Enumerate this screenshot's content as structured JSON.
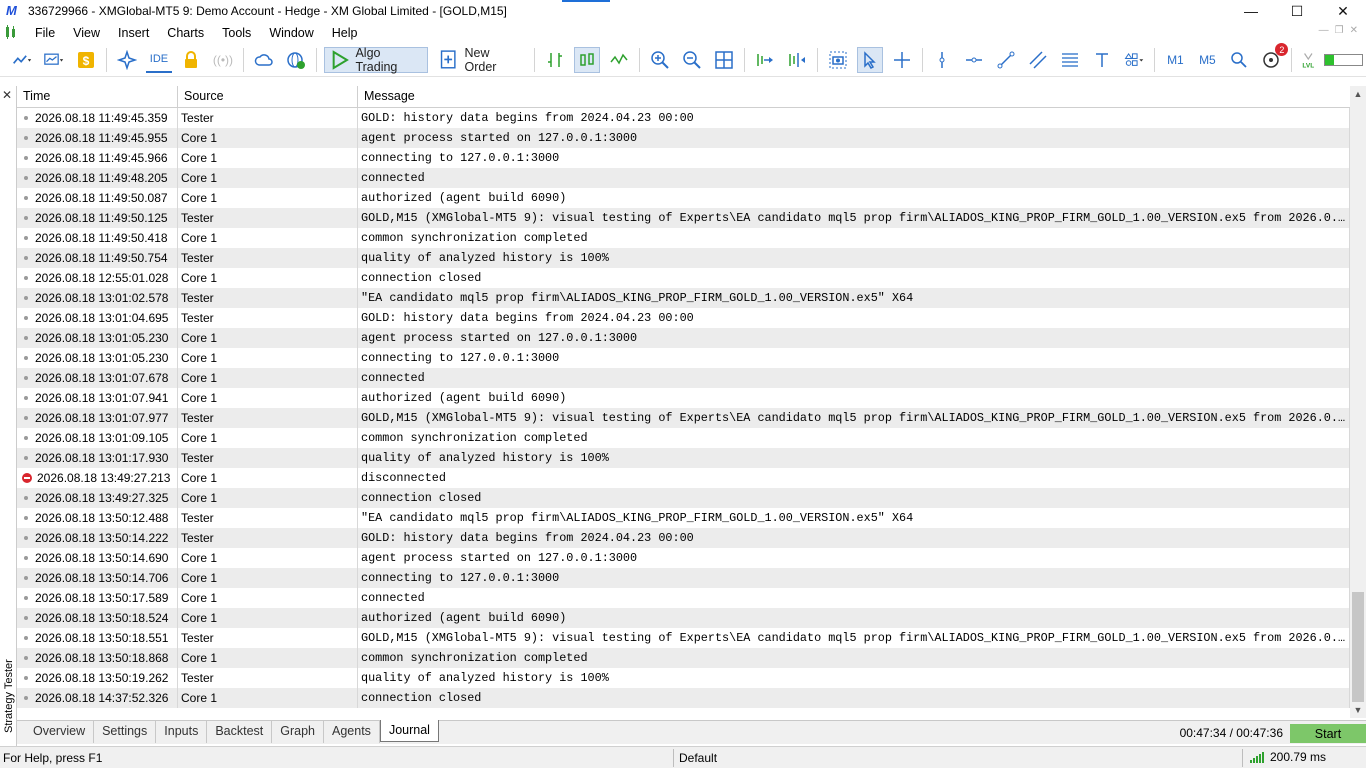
{
  "window": {
    "title": "336729966 - XMGlobal-MT5 9: Demo Account - Hedge - XM Global Limited - [GOLD,M15]",
    "logo": "M",
    "controls": [
      "minimize",
      "maximize",
      "close"
    ]
  },
  "menu": {
    "items": [
      "File",
      "View",
      "Insert",
      "Charts",
      "Tools",
      "Window",
      "Help"
    ]
  },
  "toolbar": {
    "ide_label": "IDE",
    "algo_trading_label": "Algo Trading",
    "new_order_label": "New Order",
    "timeframes": [
      "M1",
      "M5"
    ],
    "notifications_count": "2",
    "level_label": "LVL",
    "level_fraction": 0.25
  },
  "panel": {
    "vertical_label": "Strategy Tester",
    "close_glyph": "✕"
  },
  "journal": {
    "columns": [
      "Time",
      "Source",
      "Message"
    ],
    "rows": [
      {
        "time": "2026.08.18 11:49:45.359",
        "source": "Tester",
        "message": "GOLD: history data begins from 2024.04.23 00:00",
        "level": "info"
      },
      {
        "time": "2026.08.18 11:49:45.955",
        "source": "Core 1",
        "message": "agent process started on 127.0.0.1:3000",
        "level": "info"
      },
      {
        "time": "2026.08.18 11:49:45.966",
        "source": "Core 1",
        "message": "connecting to 127.0.0.1:3000",
        "level": "info"
      },
      {
        "time": "2026.08.18 11:49:48.205",
        "source": "Core 1",
        "message": "connected",
        "level": "info"
      },
      {
        "time": "2026.08.18 11:49:50.087",
        "source": "Core 1",
        "message": "authorized (agent build 6090)",
        "level": "info"
      },
      {
        "time": "2026.08.18 11:49:50.125",
        "source": "Tester",
        "message": "GOLD,M15 (XMGlobal-MT5 9): visual testing of Experts\\EA candidato mql5 prop firm\\ALIADOS_KING_PROP_FIRM_GOLD_1.00_VERSION.ex5 from 2026.0...",
        "level": "info"
      },
      {
        "time": "2026.08.18 11:49:50.418",
        "source": "Core 1",
        "message": "common synchronization completed",
        "level": "info"
      },
      {
        "time": "2026.08.18 11:49:50.754",
        "source": "Tester",
        "message": "quality of analyzed history is 100%",
        "level": "info"
      },
      {
        "time": "2026.08.18 12:55:01.028",
        "source": "Core 1",
        "message": "connection closed",
        "level": "info"
      },
      {
        "time": "2026.08.18 13:01:02.578",
        "source": "Tester",
        "message": "\"EA candidato mql5 prop firm\\ALIADOS_KING_PROP_FIRM_GOLD_1.00_VERSION.ex5\" X64",
        "level": "info"
      },
      {
        "time": "2026.08.18 13:01:04.695",
        "source": "Tester",
        "message": "GOLD: history data begins from 2024.04.23 00:00",
        "level": "info"
      },
      {
        "time": "2026.08.18 13:01:05.230",
        "source": "Core 1",
        "message": "agent process started on 127.0.0.1:3000",
        "level": "info"
      },
      {
        "time": "2026.08.18 13:01:05.230",
        "source": "Core 1",
        "message": "connecting to 127.0.0.1:3000",
        "level": "info"
      },
      {
        "time": "2026.08.18 13:01:07.678",
        "source": "Core 1",
        "message": "connected",
        "level": "info"
      },
      {
        "time": "2026.08.18 13:01:07.941",
        "source": "Core 1",
        "message": "authorized (agent build 6090)",
        "level": "info"
      },
      {
        "time": "2026.08.18 13:01:07.977",
        "source": "Tester",
        "message": "GOLD,M15 (XMGlobal-MT5 9): visual testing of Experts\\EA candidato mql5 prop firm\\ALIADOS_KING_PROP_FIRM_GOLD_1.00_VERSION.ex5 from 2026.0...",
        "level": "info"
      },
      {
        "time": "2026.08.18 13:01:09.105",
        "source": "Core 1",
        "message": "common synchronization completed",
        "level": "info"
      },
      {
        "time": "2026.08.18 13:01:17.930",
        "source": "Tester",
        "message": "quality of analyzed history is 100%",
        "level": "info"
      },
      {
        "time": "2026.08.18 13:49:27.213",
        "source": "Core 1",
        "message": "disconnected",
        "level": "error"
      },
      {
        "time": "2026.08.18 13:49:27.325",
        "source": "Core 1",
        "message": "connection closed",
        "level": "info"
      },
      {
        "time": "2026.08.18 13:50:12.488",
        "source": "Tester",
        "message": "\"EA candidato mql5 prop firm\\ALIADOS_KING_PROP_FIRM_GOLD_1.00_VERSION.ex5\" X64",
        "level": "info"
      },
      {
        "time": "2026.08.18 13:50:14.222",
        "source": "Tester",
        "message": "GOLD: history data begins from 2024.04.23 00:00",
        "level": "info"
      },
      {
        "time": "2026.08.18 13:50:14.690",
        "source": "Core 1",
        "message": "agent process started on 127.0.0.1:3000",
        "level": "info"
      },
      {
        "time": "2026.08.18 13:50:14.706",
        "source": "Core 1",
        "message": "connecting to 127.0.0.1:3000",
        "level": "info"
      },
      {
        "time": "2026.08.18 13:50:17.589",
        "source": "Core 1",
        "message": "connected",
        "level": "info"
      },
      {
        "time": "2026.08.18 13:50:18.524",
        "source": "Core 1",
        "message": "authorized (agent build 6090)",
        "level": "info"
      },
      {
        "time": "2026.08.18 13:50:18.551",
        "source": "Tester",
        "message": "GOLD,M15 (XMGlobal-MT5 9): visual testing of Experts\\EA candidato mql5 prop firm\\ALIADOS_KING_PROP_FIRM_GOLD_1.00_VERSION.ex5 from 2026.0...",
        "level": "info"
      },
      {
        "time": "2026.08.18 13:50:18.868",
        "source": "Core 1",
        "message": "common synchronization completed",
        "level": "info"
      },
      {
        "time": "2026.08.18 13:50:19.262",
        "source": "Tester",
        "message": "quality of analyzed history is 100%",
        "level": "info"
      },
      {
        "time": "2026.08.18 14:37:52.326",
        "source": "Core 1",
        "message": "connection closed",
        "level": "info"
      }
    ]
  },
  "tabs": {
    "items": [
      "Overview",
      "Settings",
      "Inputs",
      "Backtest",
      "Graph",
      "Agents",
      "Journal"
    ],
    "active": "Journal",
    "time_counter": "00:47:34 / 00:47:36",
    "start_label": "Start"
  },
  "status": {
    "help": "For Help, press F1",
    "profile": "Default",
    "ping": "200.79 ms"
  },
  "colors": {
    "accent": "#2a6fc9",
    "start_button": "#7dc769",
    "error": "#d9262e",
    "signal": "#2ea12e",
    "row_alt": "#ececec"
  }
}
